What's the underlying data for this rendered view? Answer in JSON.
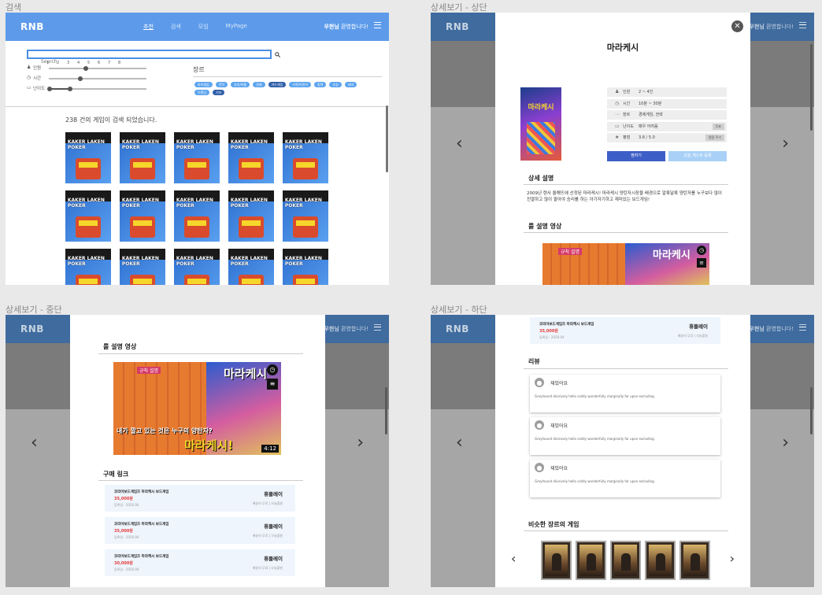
{
  "captions": {
    "search": "검색",
    "detail_top": "상세보기 - 상단",
    "detail_mid": "상세보기 - 중단",
    "detail_bottom": "상세보기 - 하단"
  },
  "nav": {
    "brand": "RNB",
    "links": [
      "추천",
      "검색",
      "모임",
      "MyPage"
    ],
    "greeting_name": "우현님",
    "greeting_text": " 환영합니다!",
    "menu_icon": "hamburger-icon"
  },
  "search": {
    "placeholder": "Search",
    "search_icon": "magnifier-icon",
    "scale_ticks": [
      "1",
      "2",
      "3",
      "4",
      "5",
      "6",
      "7",
      "8"
    ],
    "filters": [
      {
        "label": "인원",
        "icon": "people-icon",
        "value": 0.38
      },
      {
        "label": "시간",
        "icon": "clock-icon",
        "value": 0.32
      },
      {
        "label": "난이도",
        "icon": "gauge-icon",
        "value": 0.22
      }
    ],
    "genre_title": "장르",
    "genre_tags": [
      "파티게임",
      "전략",
      "추리/퍼즐",
      "경제",
      "카드게임",
      "가족/어린이",
      "협력",
      "추상",
      "테마",
      "브랜딩",
      "기타"
    ],
    "result_text": "238 건의 게임이 검색 되었습니다.",
    "game_titles": [
      "KAKER LAKEN POKER"
    ],
    "rows": 3,
    "cols": 5
  },
  "detail": {
    "title": "마라케시",
    "box_title": "마라케시",
    "close_icon": "close-icon",
    "info_rows": [
      {
        "icon": "people-icon",
        "key": "인원",
        "value": "2 ~ 4인",
        "btn": ""
      },
      {
        "icon": "clock-icon",
        "key": "시간",
        "value": "10분 ~ 30분",
        "btn": ""
      },
      {
        "icon": "tag-icon",
        "key": "장르",
        "value": "경제게임, 전략",
        "btn": ""
      },
      {
        "icon": "gauge-icon",
        "key": "난이도",
        "value": "매우 어려움",
        "btn": "투표"
      },
      {
        "icon": "star-icon",
        "key": "평점",
        "value": "3.8 / 5.0",
        "btn": "평점 주기"
      }
    ],
    "like_button": "찜하기",
    "wish_button": "오늘 게스트 등록",
    "desc_title": "상세 설명",
    "desc_text": "2009년 렌사 올해뜨에 선정된 마라케시! 마라케시 양탄자시장을 배경으로 알록달록 양탄자를 누구보다 많이 진열하고 많이 팔아야 승리를 하는 아기자기하고 재미있는 보드게임!",
    "video_title": "룰 설명 영상",
    "video_overlay_top": "규칙 설명",
    "video_caption": "내가 깔고 있는 것은 누구의 양탄자?",
    "video_big": "마라케시!",
    "video_label_small": "마라케시",
    "video_time": "4:12",
    "clock_icon": "clock-icon",
    "playlist_icon": "playlist-icon",
    "buy_title": "구매 링크",
    "buy_items": [
      {
        "name": "코리아보드게임즈 마라케시 보드게임",
        "price": "35,000원",
        "date": "등록일 : 2020.04",
        "store": "휴플레이",
        "ship": "배송비 무료 | 오늘출발"
      },
      {
        "name": "코리아보드게임즈 마라케시 보드게임",
        "price": "35,000원",
        "date": "등록일 : 2020.04",
        "store": "휴플레이",
        "ship": "배송비 무료 | 오늘출발"
      },
      {
        "name": "코리아보드게임즈 마라케시 보드게임",
        "price": "30,000원",
        "date": "등록일 : 2020.04",
        "store": "휴플레이",
        "ship": "배송비 무료 | 오늘출발"
      }
    ],
    "top_item": {
      "name": "코리아보드게임즈 마라케시 보드게임",
      "price": "35,000원",
      "date": "등록일 : 2020.04",
      "store": "휴플레이",
      "ship": "배송비 무료 | 오늘출발"
    },
    "review_title": "리뷰",
    "reviews": [
      {
        "title": "재밌어요",
        "body": "Greyhound divisively hello coldly wonderfully marginally far upon excluding."
      },
      {
        "title": "재밌어요",
        "body": "Greyhound divisively hello coldly wonderfully marginally far upon excluding."
      },
      {
        "title": "재밌어요",
        "body": "Greyhound divisively hello coldly wonderfully marginally far upon excluding."
      }
    ],
    "similar_title": "비슷한 장르의 게임",
    "similar_count": 5,
    "avatar_icon": "user-icon",
    "prev_icon": "chevron-left-icon",
    "next_icon": "chevron-right-icon"
  },
  "colors": {
    "primary": "#5d9bea",
    "button_dark": "#3d5ec7",
    "button_light": "#a9d1f7",
    "price": "#e53b3b",
    "tag_bg": "#5ea5ef"
  }
}
